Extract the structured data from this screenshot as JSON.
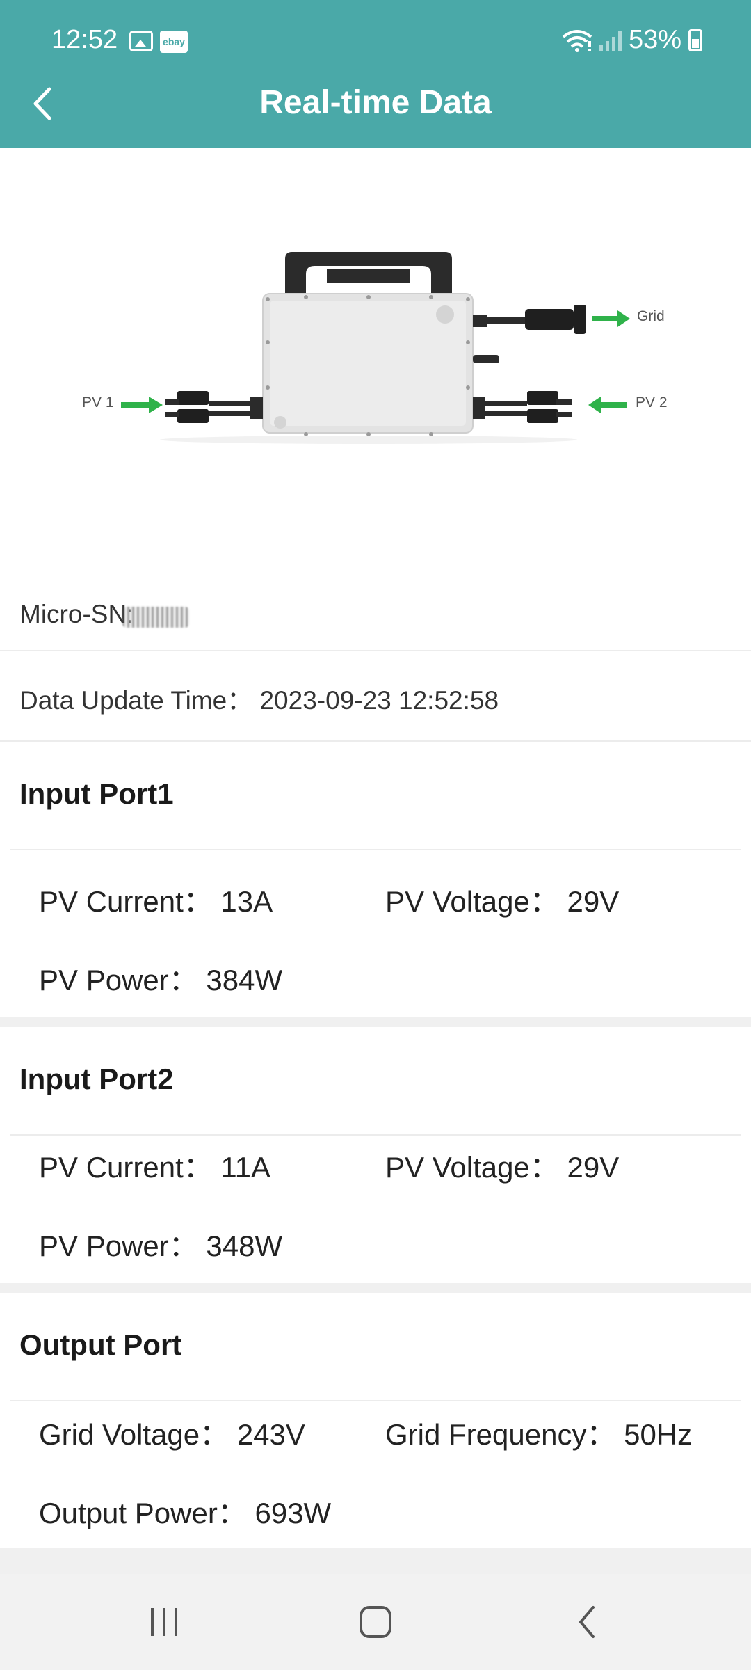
{
  "status_bar": {
    "time": "12:52",
    "notification_icons": [
      "image-icon",
      "ebay-icon"
    ],
    "ebay_label": "ebay",
    "battery": "53%"
  },
  "header": {
    "title": "Real-time Data",
    "back_icon": "chevron-left-icon"
  },
  "diagram": {
    "labels": {
      "grid": "Grid",
      "pv1": "PV 1",
      "pv2": "PV 2"
    }
  },
  "device": {
    "serial_label": "Micro-SN:"
  },
  "update": {
    "text": "Data Update Time： 2023-09-23 12:52:58"
  },
  "sections": [
    {
      "title": "Input Port1",
      "items": [
        {
          "label": "PV Current：",
          "value": "13A"
        },
        {
          "label": "PV Voltage：",
          "value": "29V"
        },
        {
          "label": "PV Power：",
          "value": "384W"
        }
      ]
    },
    {
      "title": "Input Port2",
      "items": [
        {
          "label": "PV Current：",
          "value": "11A"
        },
        {
          "label": "PV Voltage：",
          "value": "29V"
        },
        {
          "label": "PV Power：",
          "value": "348W"
        }
      ]
    },
    {
      "title": "Output Port",
      "items": [
        {
          "label": "Grid Voltage：",
          "value": "243V"
        },
        {
          "label": "Grid Frequency：",
          "value": "50Hz"
        },
        {
          "label": "Output Power：",
          "value": "693W"
        }
      ]
    }
  ],
  "colors": {
    "header_bg": "#4aa9a8",
    "arrow_green": "#2fb24a"
  },
  "navbar": {
    "icons": [
      "recent-apps-icon",
      "home-icon",
      "back-nav-icon"
    ]
  }
}
